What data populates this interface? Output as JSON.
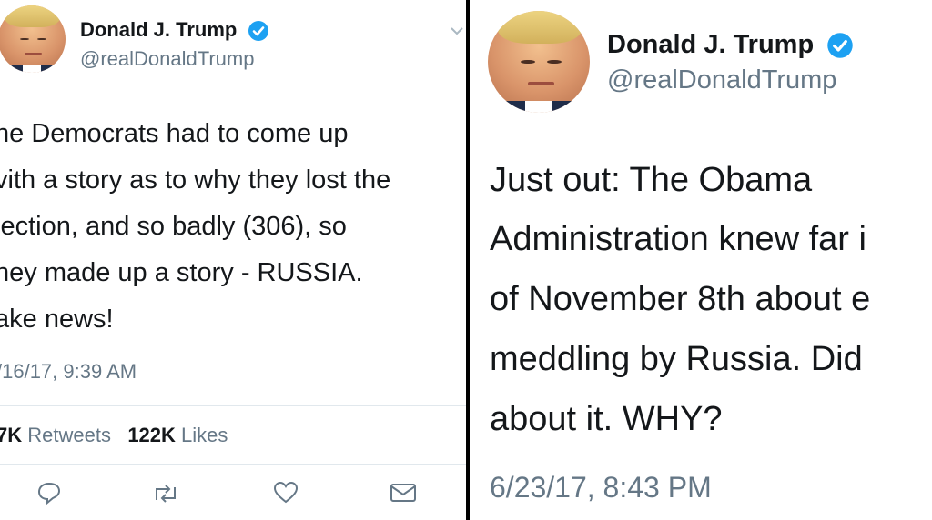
{
  "left_tweet": {
    "author_name": "Donald J. Trump",
    "author_handle": "@realDonaldTrump",
    "text_lines": [
      "he Democrats had to come up",
      "vith a story as to why they lost the",
      "lection, and so badly (306), so",
      "ney made up a story - RUSSIA.",
      "ake news!"
    ],
    "timestamp": "/16/17, 9:39 AM",
    "retweet_count": "7K",
    "retweet_label": "Retweets",
    "like_count": "122K",
    "like_label": "Likes",
    "icons": [
      "reply-icon",
      "retweet-icon",
      "like-icon",
      "message-icon",
      "chevron-down-icon",
      "verified-icon"
    ]
  },
  "right_tweet": {
    "author_name": "Donald J. Trump",
    "author_handle": "@realDonaldTrump",
    "text_lines": [
      "Just out: The Obama",
      "Administration knew far i",
      "of November 8th about e",
      "meddling by Russia. Did",
      "about it. WHY?"
    ],
    "timestamp": "6/23/17, 8:43 PM",
    "icons": [
      "verified-icon"
    ]
  },
  "colors": {
    "verified_blue": "#1da1f2",
    "muted_text": "#657786",
    "divider": "#e1e8ed",
    "background_divider": "#000000"
  }
}
